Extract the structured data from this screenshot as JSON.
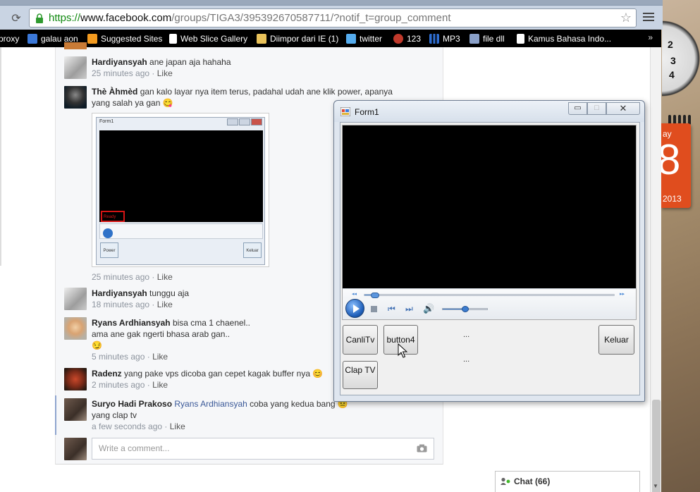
{
  "browser": {
    "url_scheme": "https://",
    "url_host": "www.facebook.com",
    "url_path": "/groups/TIGA3/395392670587711/?notif_t=group_comment",
    "bookmarks": [
      {
        "label": "proxy",
        "icon": "none",
        "color": "#000000"
      },
      {
        "label": "galau aon",
        "icon": "bookmark-favicon",
        "color": "#3b78d8"
      },
      {
        "label": "Suggested Sites",
        "icon": "suggested-sites-icon",
        "color": "#f29a1f"
      },
      {
        "label": "Web Slice Gallery",
        "icon": "page-icon",
        "color": "#ffffff"
      },
      {
        "label": "Diimpor dari IE (1)",
        "icon": "folder-icon",
        "color": "#e9c25a"
      },
      {
        "label": "twitter",
        "icon": "twitter-favicon",
        "color": "#55acee"
      },
      {
        "label": "123",
        "icon": "favicon-123",
        "color": "#c0392b"
      },
      {
        "label": "MP3",
        "icon": "mp3-bars-icon",
        "color": "#2f6fd4"
      },
      {
        "label": "file dll",
        "icon": "gear-favicon",
        "color": "#8aa0c8"
      },
      {
        "label": "Kamus Bahasa Indo...",
        "icon": "page-icon",
        "color": "#ffffff"
      }
    ],
    "more": "»"
  },
  "desktop": {
    "clock_numbers": [
      "2",
      "3",
      "4"
    ],
    "calendar_day": "ay",
    "calendar_date": "8",
    "calendar_year": "2013"
  },
  "feed": {
    "comments": [
      {
        "author": "Hardiyansyah",
        "text": "ane japan aja hahaha",
        "time": "25 minutes ago",
        "like": "Like"
      },
      {
        "author": "Thè Àhmèd",
        "text": "gan kalo layar nya item terus, padahal udah ane klik power, apanya yang salah ya gan 😋",
        "time": "25 minutes ago",
        "like": "Like"
      },
      {
        "author": "Hardiyansyah",
        "text": "tunggu aja",
        "time": "18 minutes ago",
        "like": "Like"
      },
      {
        "author": "Ryans Ardhiansyah",
        "text": "bisa cma 1 chaenel..",
        "text2": "ama ane gak ngerti bhasa arab gan..",
        "text3": "😏",
        "time": "5 minutes ago",
        "like": "Like"
      },
      {
        "author": "Radenz",
        "text": "yang pake vps dicoba gan cepet kagak buffer nya 😊",
        "time": "2 minutes ago",
        "like": "Like"
      },
      {
        "author": "Suryo Hadi Prakoso",
        "mention": "Ryans Ardhiansyah",
        "text": "coba yang kedua bang 😐",
        "text2": "yang clap tv",
        "time": "a few seconds ago",
        "like": "Like"
      }
    ],
    "shot": {
      "title": "Form1",
      "ready": "Ready",
      "power": "Power",
      "keluar": "Keluar"
    },
    "comment_placeholder": "Write a comment..."
  },
  "chat": {
    "label": "Chat (66)"
  },
  "form1": {
    "title": "Form1",
    "min": "▭",
    "max": "□",
    "close": "✕",
    "buttons": {
      "canlitv": "CanliTv",
      "button4": "button4",
      "keluar": "Keluar",
      "claptv": "Clap TV"
    },
    "dots_top": "...",
    "dots_bottom": "...",
    "seek_position": 0.03,
    "volume_level": 0.5
  }
}
